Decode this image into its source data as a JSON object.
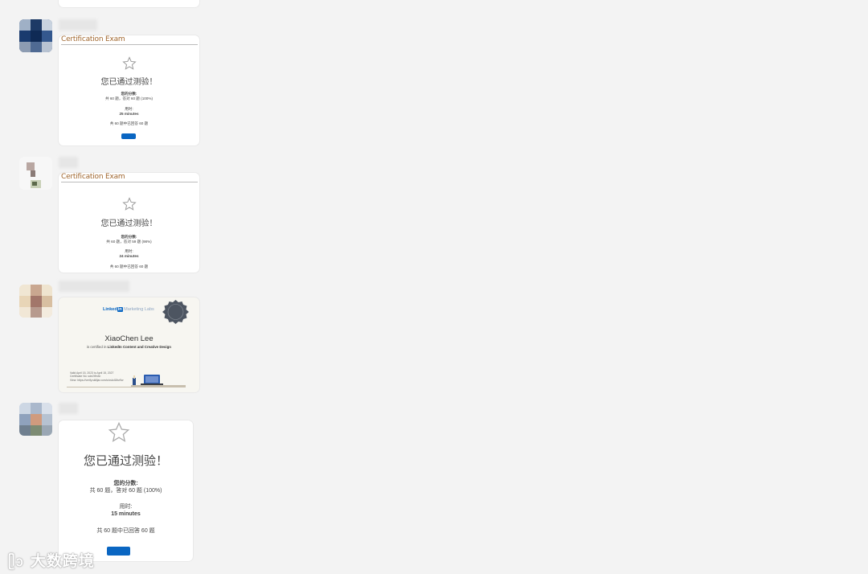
{
  "messages": [
    {
      "type": "exam",
      "exam_title": "Certification Exam",
      "pass_text": "您已通过测验！",
      "score_label": "您的分数:",
      "score_line": "共 60 题，答对 60 题 (100%)",
      "time_label": "用时:",
      "time_value": "25 minutes",
      "answered_line": "共 60 题中已回答 60 题"
    },
    {
      "type": "exam",
      "exam_title": "Certification Exam",
      "pass_text": "您已通过测验！",
      "score_label": "您的分数:",
      "score_line": "共 60 题，答对 59 题 (98%)",
      "time_label": "用时:",
      "time_value": "24 minutes",
      "answered_line": "共 60 题中已回答 60 题"
    },
    {
      "type": "certificate",
      "brand_linked": "Linked",
      "brand_in": "in",
      "brand_rest": "Marketing Labs",
      "name": "XiaoChen Lee",
      "certified_prefix": "is certified in",
      "certified_course": "LinkedIn Content and Creative Design",
      "valid_line": "Valid April 15, 2023 to April 15, 2027",
      "cert_no_line": "Certificate No: sde2t9n3n",
      "view_line": "View: https://verify.skilljar.com/c/oskd18sr9w"
    },
    {
      "type": "exam_large",
      "pass_text": "您已通过测验！",
      "score_label": "您的分数:",
      "score_line": "共 60 题，答对 60 题 (100%)",
      "time_label": "用时:",
      "time_value": "15 minutes",
      "answered_line": "共 60 题中已回答 60 题"
    }
  ],
  "watermark": "大数跨境",
  "colors": {
    "background": "#f3f3f3",
    "exam_title": "#a0662d",
    "button": "#0a66c2",
    "linkedin_blue": "#0a66c2"
  }
}
